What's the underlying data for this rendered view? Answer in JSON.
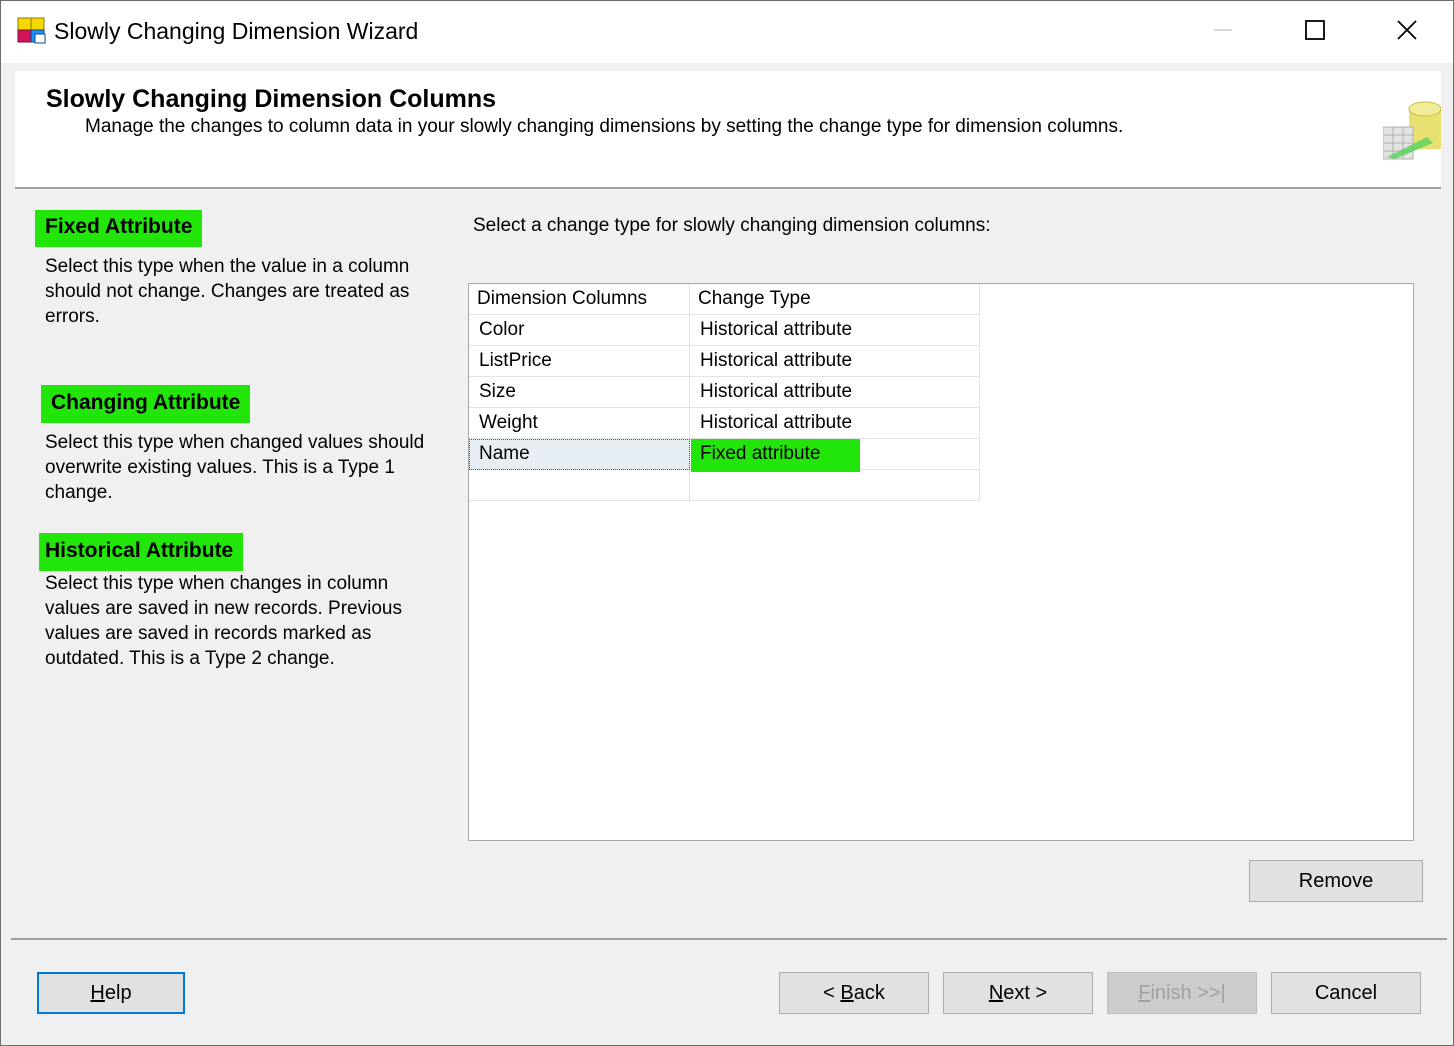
{
  "window": {
    "title": "Slowly Changing Dimension Wizard"
  },
  "header": {
    "title": "Slowly Changing Dimension Columns",
    "subtitle": "Manage the changes to column data in your slowly changing dimensions by setting the change type for dimension columns."
  },
  "descriptions": [
    {
      "label": "Fixed Attribute",
      "text": "Select this type when the value in a column should not change. Changes are treated as errors."
    },
    {
      "label": "Changing Attribute",
      "text": "Select this type when changed values should overwrite existing values. This is a Type 1 change."
    },
    {
      "label": "Historical Attribute",
      "text": "Select this type when changes in column values are saved in new records. Previous values are saved in records marked as outdated. This is a Type 2 change."
    }
  ],
  "prompt": "Select a change type for slowly changing dimension columns:",
  "grid": {
    "headers": [
      "Dimension Columns",
      "Change Type"
    ],
    "rows": [
      {
        "column": "Color",
        "type": "Historical attribute"
      },
      {
        "column": "ListPrice",
        "type": "Historical attribute"
      },
      {
        "column": "Size",
        "type": "Historical attribute"
      },
      {
        "column": "Weight",
        "type": "Historical attribute"
      },
      {
        "column": "Name",
        "type": "Fixed attribute"
      }
    ]
  },
  "buttons": {
    "remove": "Remove",
    "help_accel": "H",
    "help_rest": "elp",
    "back_pre": "< ",
    "back_accel": "B",
    "back_rest": "ack",
    "next_accel": "N",
    "next_rest": "ext >",
    "finish_accel": "F",
    "finish_rest": "inish >>|",
    "cancel": "Cancel"
  },
  "colors": {
    "highlight": "#22e60a",
    "focus": "#0078d7"
  }
}
